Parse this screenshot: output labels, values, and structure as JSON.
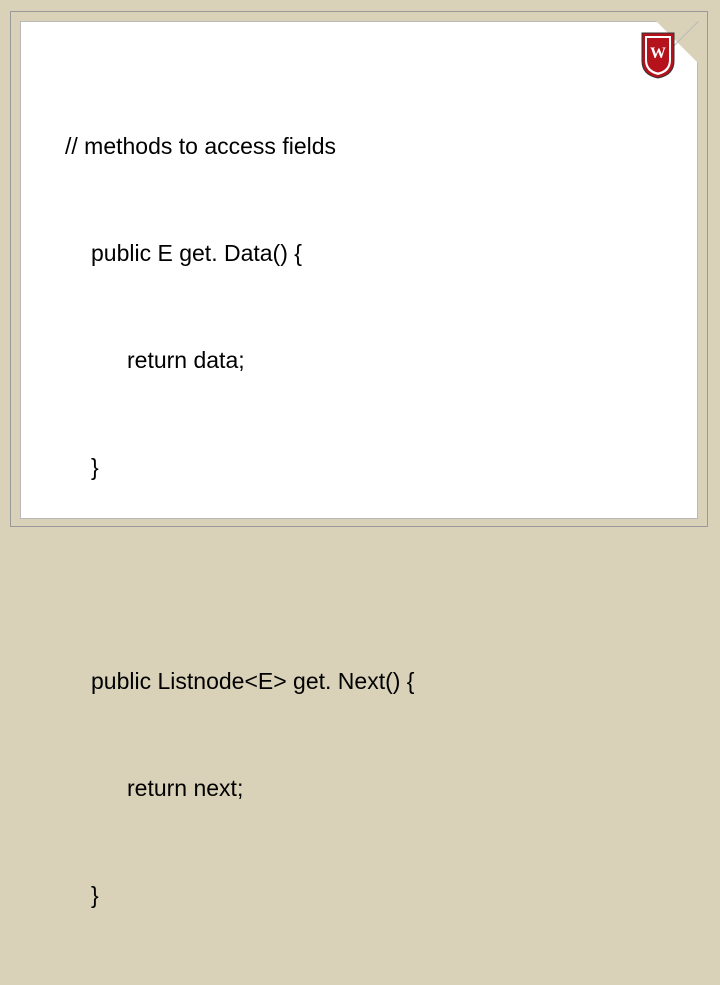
{
  "slide": {
    "crest_letter": "W",
    "code": {
      "l1": "// methods to access fields",
      "l2": "public E get. Data() {",
      "l3": "return data;",
      "l4": "}",
      "l5": "public Listnode<E> get. Next() {",
      "l6": "return next;",
      "l7": "}"
    }
  }
}
